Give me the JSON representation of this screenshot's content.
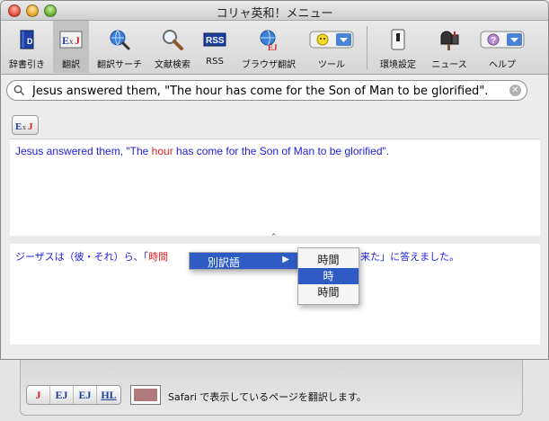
{
  "window": {
    "title": "コリャ英和！メニュー"
  },
  "toolbar": {
    "items": [
      {
        "label": "辞書引き",
        "icon": "dictionary-book-icon"
      },
      {
        "label": "翻訳",
        "icon": "ej-translate-icon",
        "selected": true
      },
      {
        "label": "翻訳サーチ",
        "icon": "globe-search-icon"
      },
      {
        "label": "文献検索",
        "icon": "magnifier-icon"
      },
      {
        "label": "RSS",
        "icon": "rss-icon"
      },
      {
        "label": "ブラウザ翻訳",
        "icon": "browser-translate-icon"
      },
      {
        "label": "ツール",
        "icon": "smiley-popup-icon"
      },
      {
        "label": "環境設定",
        "icon": "switch-icon"
      },
      {
        "label": "ニュース",
        "icon": "mailbox-icon"
      },
      {
        "label": "ヘルプ",
        "icon": "help-popup-icon"
      }
    ]
  },
  "search": {
    "value": "Jesus answered them, \"The hour has come for the Son of Man to be glorified\"."
  },
  "source": {
    "before": "Jesus answered them, \"The ",
    "highlight": "hour",
    "after": " has come for the Son of Man to be glorified\"."
  },
  "translation": {
    "before": "ジーザスは（彼・それ）ら、「",
    "highlight": "時間",
    "after": "めに来た」に答えました。"
  },
  "context_menu": {
    "item": "別訳語",
    "submenu": [
      "時間",
      "時",
      "時間"
    ],
    "selected_index": 1
  },
  "drawer": {
    "modes": [
      "J",
      "EJ",
      "EJ",
      "HL"
    ],
    "status": "Safari で表示しているページを翻訳します。"
  },
  "colors": {
    "source_text": "#1e1ee0",
    "highlight": "#e02020",
    "menu_selection": "#2f5bc4",
    "swatch": "#b07a7a"
  }
}
